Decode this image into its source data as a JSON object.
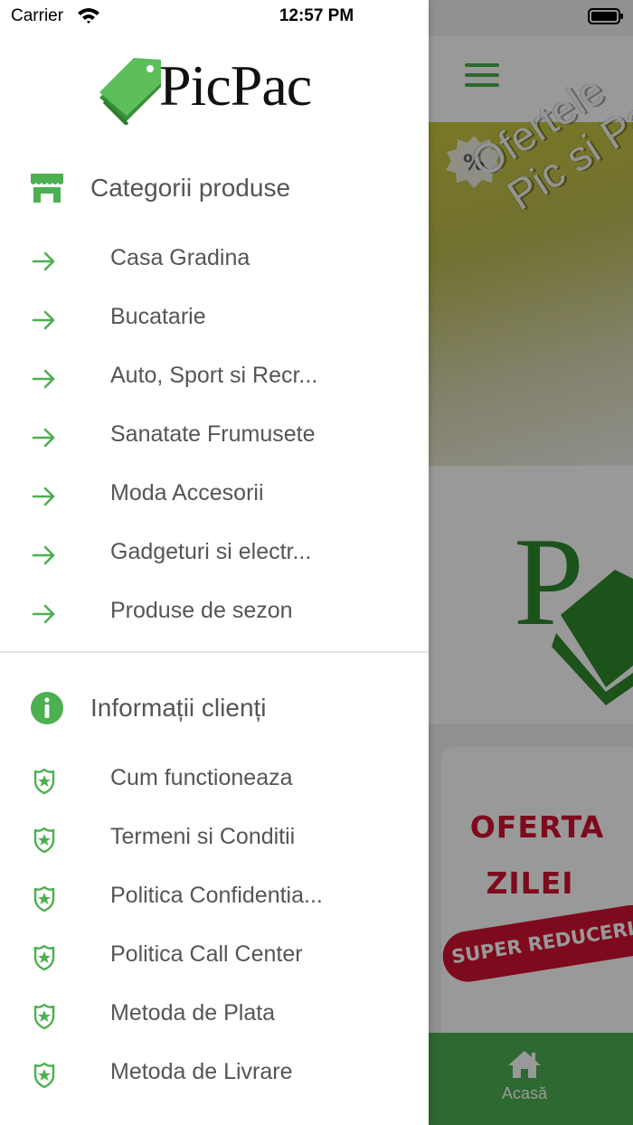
{
  "status_bar": {
    "carrier": "Carrier",
    "time": "12:57 PM"
  },
  "brand": {
    "name": "PicPac"
  },
  "colors": {
    "accent": "#4caf50",
    "offer_red": "#d31131"
  },
  "drawer": {
    "categories": {
      "title": "Categorii produse",
      "icon": "store-icon",
      "items": [
        {
          "label": "Casa Gradina",
          "icon": "arrow-right-icon"
        },
        {
          "label": "Bucatarie",
          "icon": "arrow-right-icon"
        },
        {
          "label": "Auto, Sport si Recr...",
          "icon": "arrow-right-icon"
        },
        {
          "label": "Sanatate Frumusete",
          "icon": "arrow-right-icon"
        },
        {
          "label": "Moda Accesorii",
          "icon": "arrow-right-icon"
        },
        {
          "label": "Gadgeturi si electr...",
          "icon": "arrow-right-icon"
        },
        {
          "label": "Produse de sezon",
          "icon": "arrow-right-icon"
        }
      ]
    },
    "info": {
      "title": "Informații clienți",
      "icon": "info-icon",
      "items": [
        {
          "label": "Cum functioneaza",
          "icon": "badge-star-icon"
        },
        {
          "label": "Termeni si Conditii",
          "icon": "badge-star-icon"
        },
        {
          "label": "Politica Confidentia...",
          "icon": "badge-star-icon"
        },
        {
          "label": "Politica Call Center",
          "icon": "badge-star-icon"
        },
        {
          "label": "Metoda de Plata",
          "icon": "badge-star-icon"
        },
        {
          "label": "Metoda de Livrare",
          "icon": "badge-star-icon"
        }
      ]
    }
  },
  "background_app": {
    "banner": {
      "line1": "Ofertele",
      "line2": "Pic si Pa",
      "badge": "%"
    },
    "offer": {
      "title_line1": "OFERTA",
      "title_line2": "ZILEI",
      "ribbon": "SUPER REDUCERI"
    },
    "tab_bar": {
      "home_label": "Acasă"
    }
  }
}
